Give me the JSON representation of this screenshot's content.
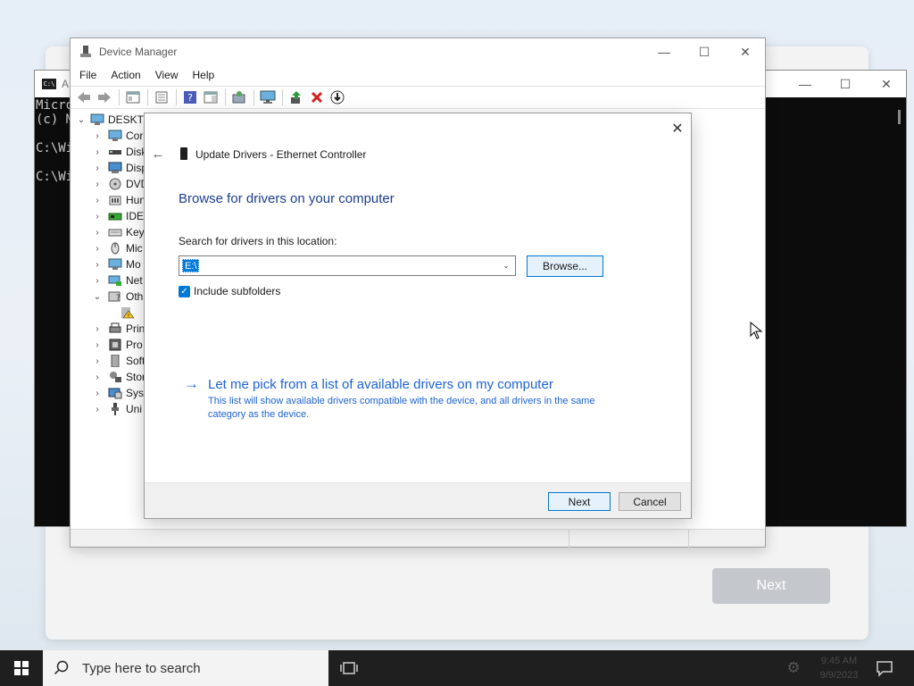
{
  "setup": {
    "next_label": "Next"
  },
  "cmd": {
    "title": "A",
    "lines": [
      "Micro",
      "(c) M",
      "",
      "C:\\Wi",
      "",
      "C:\\Wi"
    ],
    "minimize": "—",
    "maximize": "☐",
    "close": "✕"
  },
  "device_manager": {
    "title": "Device Manager",
    "minimize": "—",
    "maximize": "☐",
    "close": "✕",
    "menu": [
      "File",
      "Action",
      "View",
      "Help"
    ],
    "tree": [
      {
        "label": "DESKTO",
        "chev": "⌄"
      },
      {
        "label": "Cor",
        "chev": "›"
      },
      {
        "label": "Disk",
        "chev": "›"
      },
      {
        "label": "Disp",
        "chev": "›"
      },
      {
        "label": "DVD",
        "chev": "›"
      },
      {
        "label": "Hun",
        "chev": "›"
      },
      {
        "label": "IDE",
        "chev": "›"
      },
      {
        "label": "Key",
        "chev": "›"
      },
      {
        "label": "Mic",
        "chev": "›"
      },
      {
        "label": "Mo",
        "chev": "›"
      },
      {
        "label": "Net",
        "chev": "›"
      },
      {
        "label": "Oth",
        "chev": "⌄"
      },
      {
        "label": "",
        "chev": ""
      },
      {
        "label": "Prin",
        "chev": "›"
      },
      {
        "label": "Pro",
        "chev": "›"
      },
      {
        "label": "Soft",
        "chev": "›"
      },
      {
        "label": "Stor",
        "chev": "›"
      },
      {
        "label": "Syst",
        "chev": "›"
      },
      {
        "label": "Uni",
        "chev": "›"
      }
    ]
  },
  "dialog": {
    "close": "✕",
    "back": "←",
    "title": "Update Drivers - Ethernet Controller",
    "heading": "Browse for drivers on your computer",
    "search_label": "Search for drivers in this location:",
    "path_value": "E:\\",
    "combo_arrow": "⌄",
    "browse_label": "Browse...",
    "include_subfolders_label": "Include subfolders",
    "include_subfolders_checked": true,
    "check_glyph": "✓",
    "link_arrow": "→",
    "pick_link_title": "Let me pick from a list of available drivers on my computer",
    "pick_link_desc": "This list will show available drivers compatible with the device, and all drivers in the same category as the device.",
    "next_label": "Next",
    "cancel_label": "Cancel"
  },
  "taskbar": {
    "search_placeholder": "Type here to search",
    "time": "9:45 AM",
    "date": "9/9/2023",
    "gear": "⚙"
  },
  "colors": {
    "accent": "#0078d7",
    "heading_blue": "#1e3d8f",
    "link_blue": "#1d63d3",
    "delete_red": "#d61f1f"
  }
}
